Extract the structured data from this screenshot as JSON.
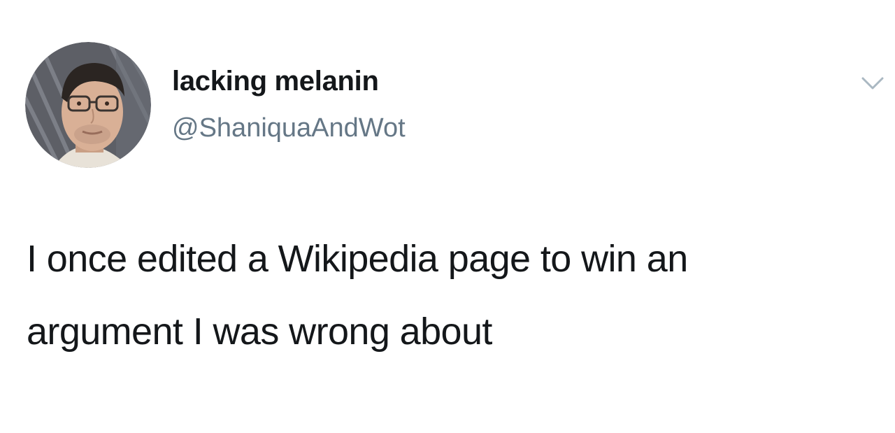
{
  "tweet": {
    "author": {
      "display_name": "lacking melanin",
      "handle": "@ShaniquaAndWot",
      "avatar_icon": "user-avatar-photo"
    },
    "menu_icon": "chevron-down-icon",
    "text_lines": [
      "I once edited a Wikipedia page to win an",
      "argument I was wrong about"
    ],
    "colors": {
      "name": "#14171a",
      "handle": "#657786",
      "chevron": "#aab8c2",
      "background": "#ffffff"
    }
  }
}
